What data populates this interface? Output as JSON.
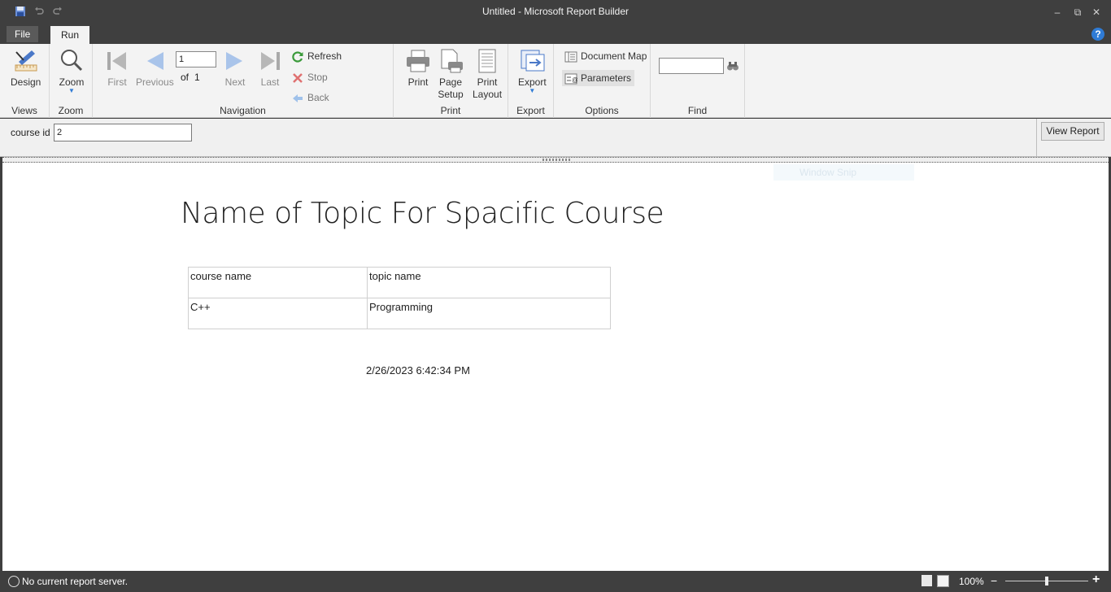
{
  "window": {
    "title": "Untitled - Microsoft Report Builder",
    "minimize": "–",
    "restore": "⧉",
    "close": "✕"
  },
  "tabs": {
    "file": "File",
    "run": "Run",
    "help": "?"
  },
  "ribbon": {
    "views": {
      "label": "Views",
      "design": "Design"
    },
    "zoom": {
      "label": "Zoom",
      "zoom": "Zoom"
    },
    "navigation": {
      "label": "Navigation",
      "first": "First",
      "previous": "Previous",
      "current_page": "1",
      "of_label": "of",
      "total_pages": "1",
      "next": "Next",
      "last": "Last",
      "refresh": "Refresh",
      "stop": "Stop",
      "back": "Back"
    },
    "print": {
      "label": "Print",
      "print": "Print",
      "page_setup_1": "Page",
      "page_setup_2": "Setup",
      "print_layout_1": "Print",
      "print_layout_2": "Layout"
    },
    "export": {
      "label": "Export",
      "export": "Export"
    },
    "options": {
      "label": "Options",
      "document_map": "Document Map",
      "parameters": "Parameters"
    },
    "find": {
      "label": "Find",
      "value": ""
    }
  },
  "parameters": {
    "course_id_label": "course id",
    "course_id_value": "2",
    "view_report": "View Report"
  },
  "report": {
    "ghost_text": "Window Snip",
    "title": "Name of Topic For Spacific Course",
    "table": {
      "headers": [
        "course name",
        "topic name"
      ],
      "rows": [
        [
          "C++",
          "Programming"
        ]
      ]
    },
    "timestamp": "2/26/2023 6:42:34 PM"
  },
  "status": {
    "text": "No current report server.",
    "zoom": "100%"
  },
  "colors": {
    "chrome": "#3f3f3f",
    "ribbon": "#f3f3f3",
    "accent_blue": "#2f7bd5"
  }
}
